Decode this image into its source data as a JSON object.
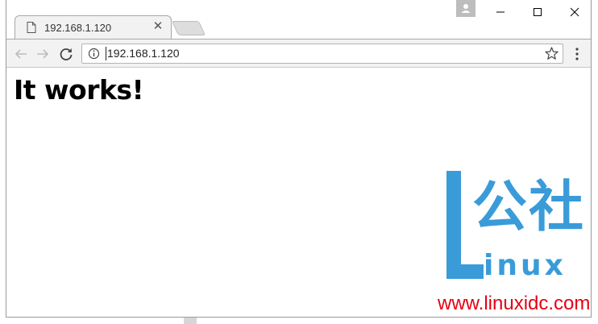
{
  "browser": {
    "tab": {
      "title": "192.168.1.120",
      "favicon_icon": "page-icon",
      "close_icon": "close-icon",
      "close_glyph": "✕"
    },
    "new_tab_icon": "new-tab-icon",
    "window_controls": {
      "profile_icon": "user-icon",
      "minimize_icon": "minimize-icon",
      "maximize_icon": "maximize-icon",
      "close_icon": "close-icon"
    },
    "toolbar": {
      "back_icon": "arrow-left-icon",
      "forward_icon": "arrow-right-icon",
      "reload_icon": "reload-icon",
      "address": "192.168.1.120",
      "info_icon": "info-icon",
      "bookmark_icon": "star-icon",
      "menu_icon": "more-vertical-icon"
    }
  },
  "page": {
    "heading": "It works!"
  },
  "watermark": {
    "logo_letter": "L",
    "chinese_text": "公社",
    "linux_text": "inux",
    "site_url": "www.linuxidc.com"
  },
  "colors": {
    "watermark_blue": "#3a9bd9",
    "watermark_red": "#e60012",
    "chrome_gray": "#f2f2f2"
  }
}
